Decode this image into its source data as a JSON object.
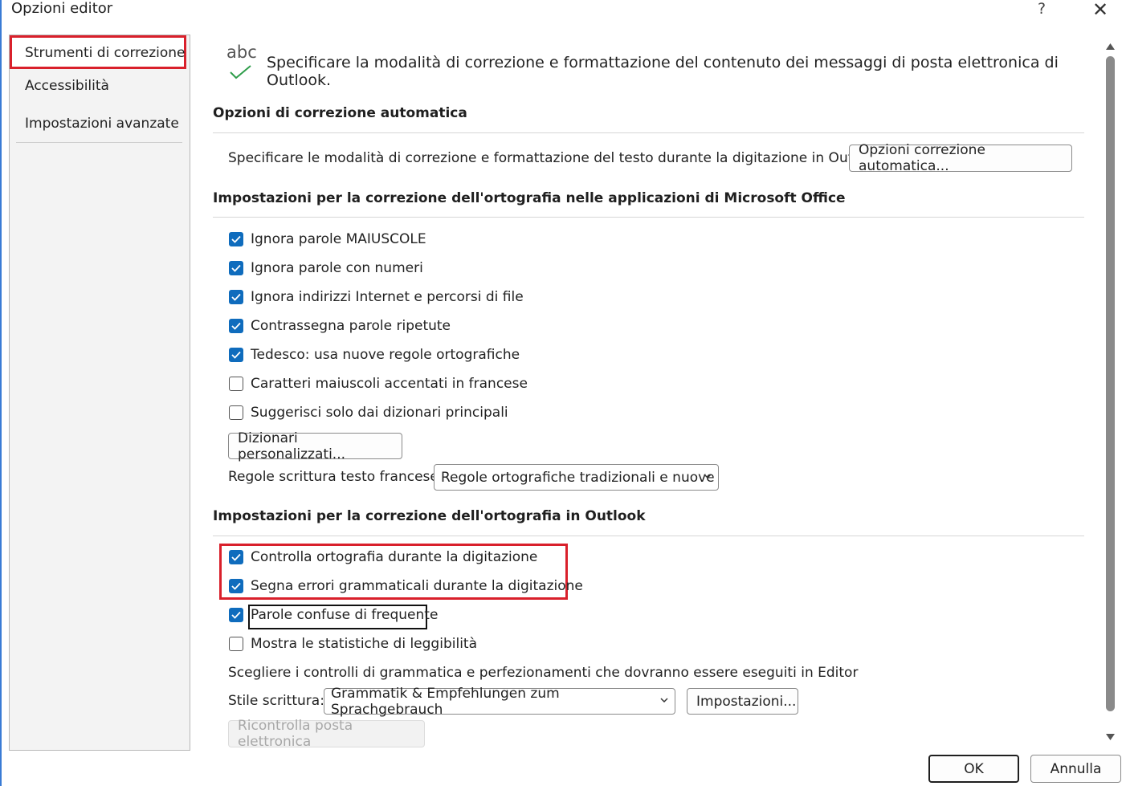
{
  "window": {
    "title": "Opzioni editor",
    "help_glyph": "?",
    "close_glyph": "✕"
  },
  "sidebar": {
    "items": [
      {
        "label": "Strumenti di correzione",
        "selected": true
      },
      {
        "label": "Accessibilità"
      },
      {
        "label": "Impostazioni avanzate"
      }
    ]
  },
  "header": {
    "icon_text": "abc",
    "description": "Specificare la modalità di correzione e formattazione del contenuto dei messaggi di posta elettronica di Outlook."
  },
  "autocorrect": {
    "heading": "Opzioni di correzione automatica",
    "text": "Specificare le modalità di correzione e formattazione del testo durante la digitazione in Outlook.",
    "button": "Opzioni correzione automatica..."
  },
  "office": {
    "heading": "Impostazioni per la correzione dell'ortografia nelle applicazioni di Microsoft Office",
    "checkboxes": [
      {
        "label": "Ignora parole MAIUSCOLE",
        "checked": true
      },
      {
        "label": "Ignora parole con numeri",
        "checked": true
      },
      {
        "label": "Ignora indirizzi Internet e percorsi di file",
        "checked": true
      },
      {
        "label": "Contrassegna parole ripetute",
        "checked": true
      },
      {
        "label": "Tedesco: usa nuove regole ortografiche",
        "checked": true
      },
      {
        "label": "Caratteri maiuscoli accentati in francese",
        "checked": false
      },
      {
        "label": "Suggerisci solo dai dizionari principali",
        "checked": false
      }
    ],
    "dict_button": "Dizionari personalizzati...",
    "french_label": "Regole scrittura testo francese:",
    "french_value": "Regole ortografiche tradizionali e nuove"
  },
  "outlook": {
    "heading": "Impostazioni per la correzione dell'ortografia in Outlook",
    "checkboxes": [
      {
        "label": "Controlla ortografia durante la digitazione",
        "checked": true
      },
      {
        "label": "Segna errori grammaticali durante la digitazione",
        "checked": true
      },
      {
        "label": "Parole confuse di frequente",
        "checked": true
      },
      {
        "label": "Mostra le statistiche di leggibilità",
        "checked": false
      }
    ],
    "choose_text": "Scegliere i controlli di grammatica e perfezionamenti che dovranno essere eseguiti in Editor",
    "style_label": "Stile scrittura:",
    "style_value": "Grammatik & Empfehlungen zum Sprachgebrauch",
    "settings_button": "Impostazioni...",
    "recheck_button": "Ricontrolla posta elettronica"
  },
  "footer": {
    "ok": "OK",
    "cancel": "Annulla"
  },
  "colors": {
    "accent": "#0f6cbd",
    "highlight": "#d9202b"
  }
}
